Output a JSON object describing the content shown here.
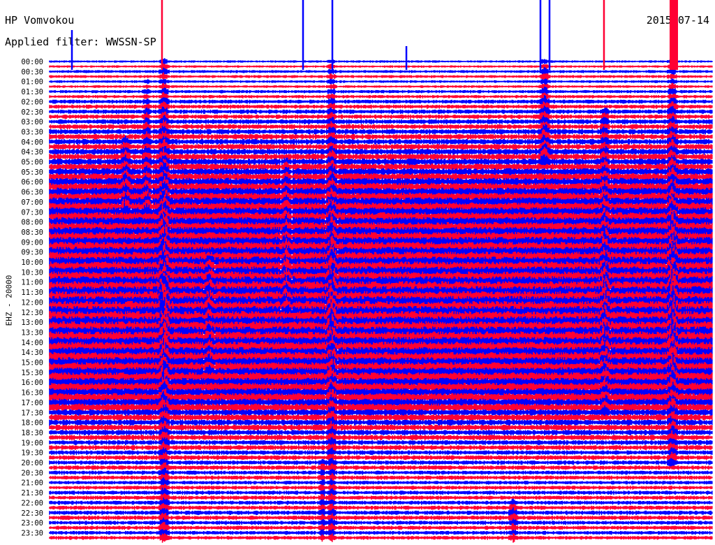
{
  "header": {
    "station": "HP Vomvokou",
    "filter": "Applied filter: WWSSN-SP",
    "date": "2015-07-14"
  },
  "chart_data": {
    "type": "line",
    "title": "HP Vomvokou",
    "subtitle": "Applied filter: WWSSN-SP",
    "date": "2015-07-14",
    "ylabel": "EHZ - 20000",
    "xlabel": "",
    "row_labels": [
      "00:00",
      "00:30",
      "01:00",
      "01:30",
      "02:00",
      "02:30",
      "03:00",
      "03:30",
      "04:00",
      "04:30",
      "05:00",
      "05:30",
      "06:00",
      "06:30",
      "07:00",
      "07:30",
      "08:00",
      "08:30",
      "09:00",
      "09:30",
      "10:00",
      "10:30",
      "11:00",
      "11:30",
      "12:00",
      "12:30",
      "13:00",
      "13:30",
      "14:00",
      "14:30",
      "15:00",
      "15:30",
      "16:00",
      "16:30",
      "17:00",
      "17:30",
      "18:00",
      "18:30",
      "19:00",
      "19:30",
      "20:00",
      "20:30",
      "21:00",
      "21:30",
      "22:00",
      "22:30",
      "23:00",
      "23:30"
    ],
    "row_minutes": 15,
    "colors": [
      "#0000ff",
      "#ff0033"
    ],
    "grid": false,
    "series": [
      {
        "values": [
          0.18,
          0.22,
          0.2,
          0.24,
          0.3,
          0.32,
          0.36,
          0.4,
          0.42,
          0.46,
          0.5,
          0.56,
          0.62,
          0.66,
          0.7,
          0.72,
          0.74,
          0.78,
          0.8,
          0.82,
          0.86,
          0.88,
          0.92,
          0.94,
          0.96,
          0.96,
          0.94,
          0.9,
          0.86,
          0.82,
          0.8,
          0.78,
          0.72,
          0.66,
          0.6,
          0.5,
          0.44,
          0.4,
          0.36,
          0.34,
          0.32,
          0.3,
          0.28,
          0.3,
          0.3,
          0.32,
          0.3,
          0.28
        ]
      }
    ]
  }
}
